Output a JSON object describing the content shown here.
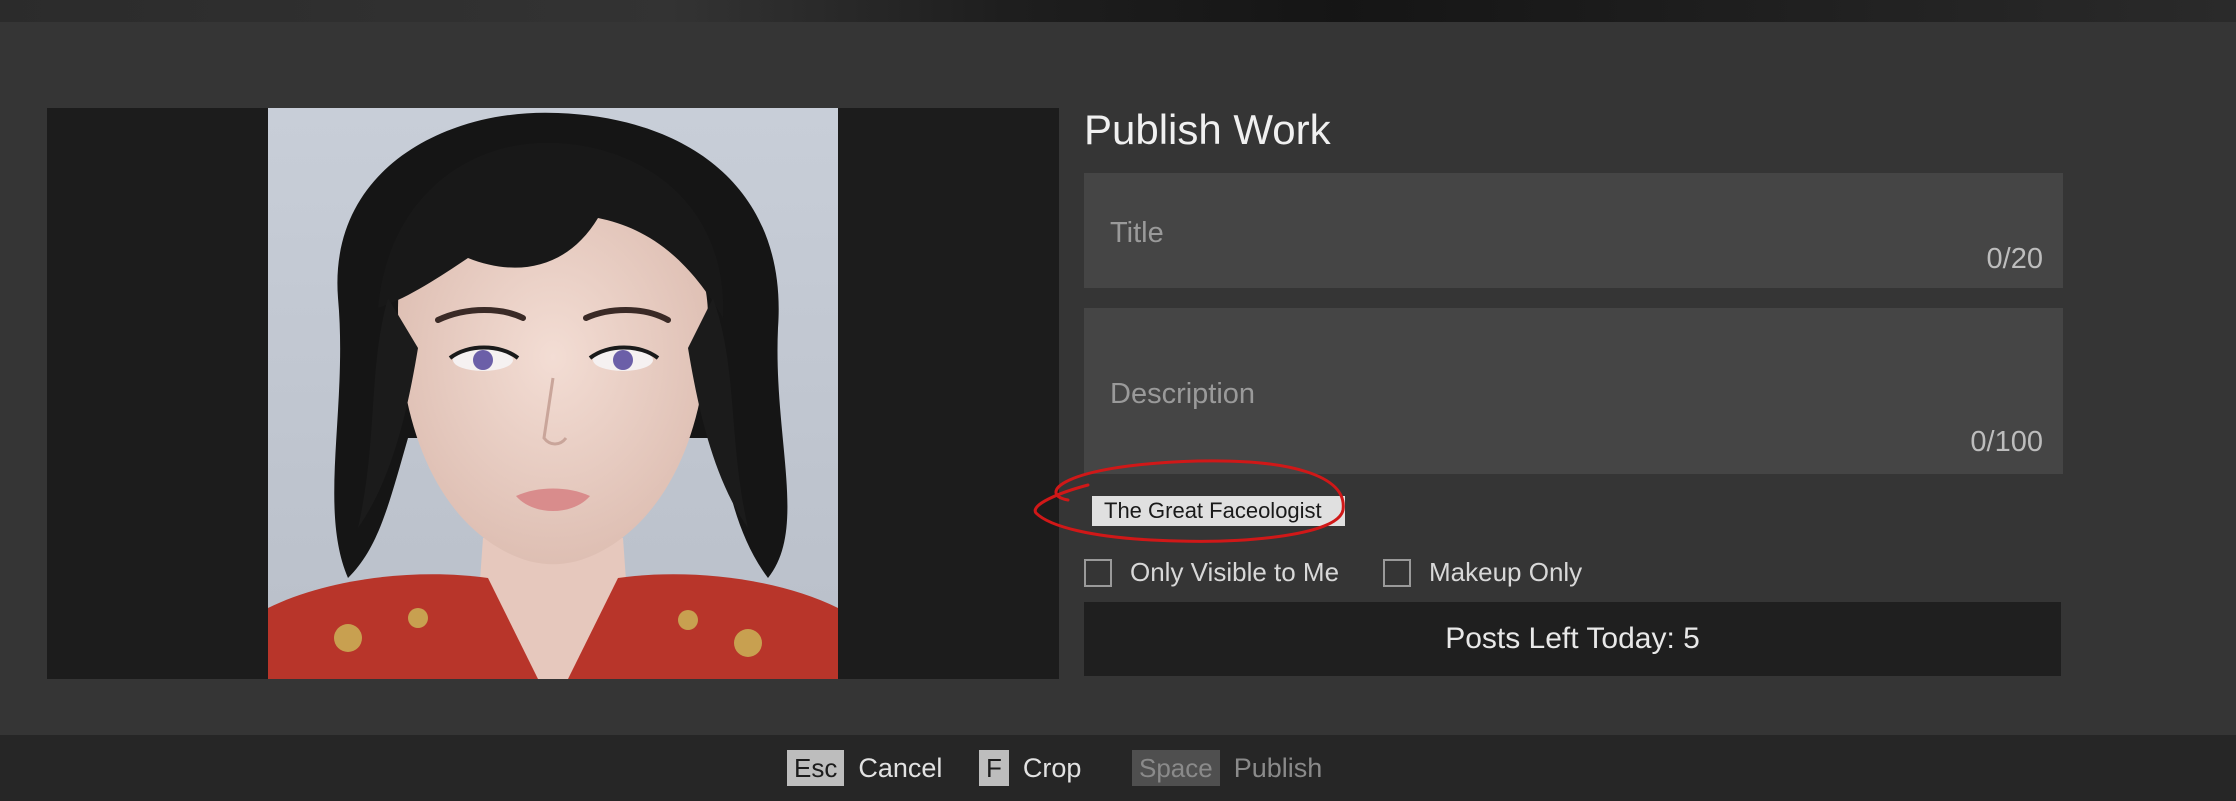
{
  "dialog": {
    "heading": "Publish Work",
    "title_field": {
      "placeholder": "Title",
      "counter": "0/20"
    },
    "description_field": {
      "placeholder": "Description",
      "counter": "0/100"
    },
    "tag": "The Great Faceologist",
    "options": [
      {
        "label": "Only Visible to Me",
        "checked": false
      },
      {
        "label": "Makeup Only",
        "checked": false
      }
    ],
    "posts_left": "Posts Left Today: 5"
  },
  "footer": {
    "hints": [
      {
        "key": "Esc",
        "label": "Cancel",
        "enabled": true
      },
      {
        "key": "F",
        "label": "Crop",
        "enabled": true
      },
      {
        "key": "Space",
        "label": "Publish",
        "enabled": false
      }
    ]
  },
  "colors": {
    "annotation": "#d01818",
    "panel": "#353535",
    "field": "#454545"
  }
}
